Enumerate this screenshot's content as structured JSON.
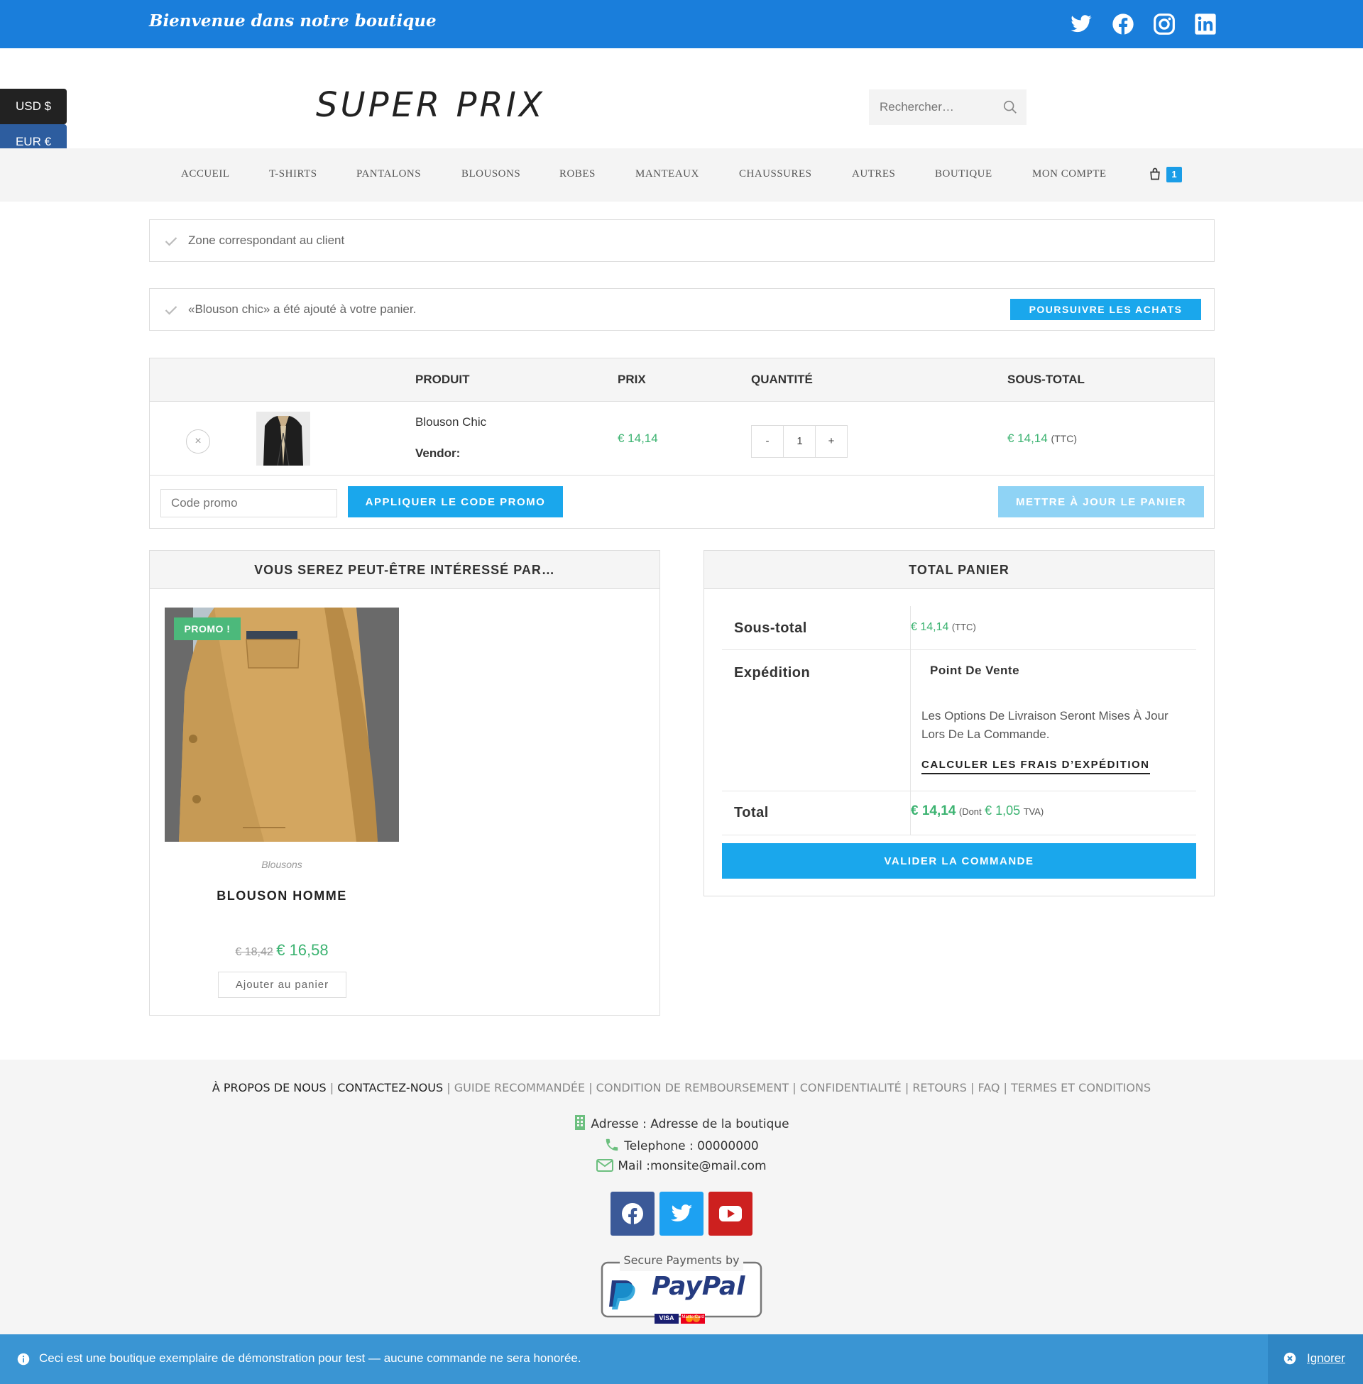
{
  "topbar": {
    "welcome": "Bienvenue dans notre boutique",
    "social_icons": [
      "twitter-icon",
      "facebook-icon",
      "instagram-icon",
      "linkedin-icon"
    ],
    "color": "#1a7edb"
  },
  "currency": {
    "usd": "USD $",
    "eur": "EUR €"
  },
  "header": {
    "logo": "SUPER PRIX",
    "search_placeholder": "Rechercher…"
  },
  "nav": {
    "items": [
      "ACCUEIL",
      "T-SHIRTS",
      "PANTALONS",
      "BLOUSONS",
      "ROBES",
      "MANTEAUX",
      "CHAUSSURES",
      "AUTRES",
      "BOUTIQUE",
      "MON COMPTE"
    ],
    "cart_count": "1"
  },
  "notices": {
    "zone": "Zone correspondant au client",
    "added": "«Blouson chic» a été ajouté à votre panier.",
    "continue_button": "POURSUIVRE LES ACHATS"
  },
  "cart": {
    "headers": {
      "product": "PRODUIT",
      "price": "PRIX",
      "quantity": "QUANTITÉ",
      "subtotal": "SOUS-TOTAL"
    },
    "item": {
      "name": "Blouson Chic",
      "vendor_label": "Vendor:",
      "price": "€ 14,14",
      "quantity": "1",
      "minus": "-",
      "plus": "+",
      "subtotal": "€ 14,14",
      "tax_note": "(TTC)",
      "remove": "×"
    },
    "coupon_placeholder": "Code promo",
    "apply_button": "APPLIQUER LE CODE PROMO",
    "update_button": "METTRE À JOUR LE PANIER"
  },
  "crosssell": {
    "title": "VOUS SEREZ PEUT-ÊTRE INTÉRESSÉ PAR…",
    "product": {
      "badge": "PROMO !",
      "category": "Blousons",
      "name": "BLOUSON HOMME",
      "old_price": "€ 18,42",
      "new_price": "€ 16,58",
      "add_button": "Ajouter au panier"
    }
  },
  "totals": {
    "title": "TOTAL PANIER",
    "subtotal_label": "Sous-total",
    "subtotal_value": "€ 14,14",
    "subtotal_tax": "(TTC)",
    "shipping_label": "Expédition",
    "shipping_method": "Point De Vente",
    "shipping_note": "Les Options De Livraison Seront Mises À Jour Lors De La Commande.",
    "shipping_calc": "CALCULER LES FRAIS D’EXPÉDITION",
    "total_label": "Total",
    "total_value": "€ 14,14",
    "total_tax_prefix": "(Dont",
    "total_tax_value": "€ 1,05",
    "total_tax_suffix": "TVA)",
    "checkout_button": "VALIDER LA COMMANDE"
  },
  "footer": {
    "links": [
      "À PROPOS DE NOUS",
      "CONTACTEZ-NOUS",
      "GUIDE RECOMMANDÉE",
      "CONDITION DE REMBOURSEMENT",
      "CONFIDENTIALITÉ",
      "RETOURS",
      "FAQ",
      "TERMES ET CONDITIONS"
    ],
    "address": "Adresse : Adresse de la boutique",
    "phone": "Telephone : 00000000",
    "mail": "Mail :monsite@mail.com",
    "social_icons": [
      "facebook-icon",
      "twitter-icon",
      "youtube-icon"
    ],
    "paypal_caption": "Secure Payments by",
    "paypal_brand": "PayPal",
    "paypal_cards": [
      "VISA",
      "MasterCard"
    ]
  },
  "demo_bar": {
    "message": "Ceci est une boutique exemplaire de démonstration pour test — aucune commande ne sera honorée.",
    "dismiss": "Ignorer"
  },
  "colors": {
    "accent": "#1aa7ec",
    "price_green": "#3cb371",
    "promo_badge": "#4cb97b"
  }
}
